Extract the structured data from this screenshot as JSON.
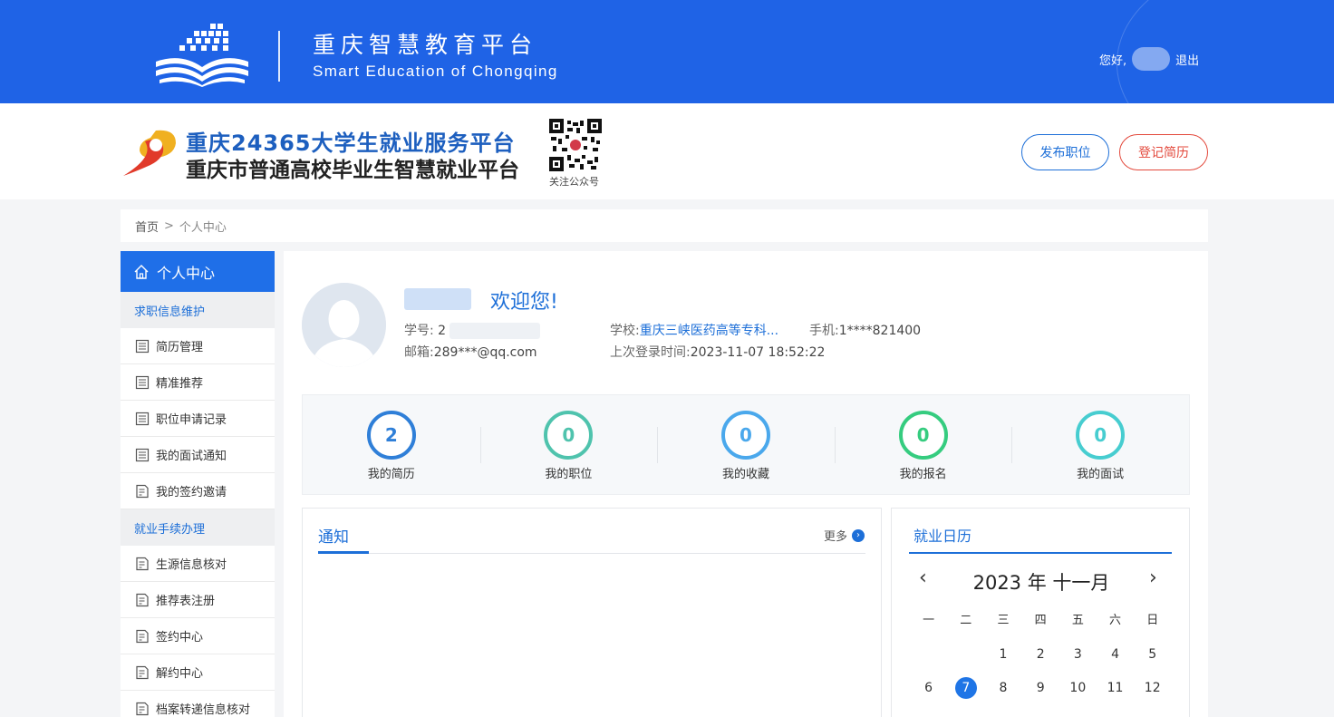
{
  "topbar": {
    "title": "重庆智慧教育平台",
    "subtitle": "Smart Education of Chongqing",
    "greeting": "您好,",
    "logout": "退出"
  },
  "header": {
    "title_line1": "重庆24365大学生就业服务平台",
    "title_line2": "重庆市普通高校毕业生智慧就业平台",
    "qr_label": "关注公众号",
    "publish_button": "发布职位",
    "register_button": "登记简历"
  },
  "breadcrumb": {
    "home": "首页",
    "separator": ">",
    "current": "个人中心"
  },
  "sidebar": {
    "head": "个人中心",
    "group1": "求职信息维护",
    "group1_items": [
      "简历管理",
      "精准推荐",
      "职位申请记录",
      "我的面试通知",
      "我的签约邀请"
    ],
    "group2": "就业手续办理",
    "group2_items": [
      "生源信息核对",
      "推荐表注册",
      "签约中心",
      "解约中心",
      "档案转递信息核对"
    ]
  },
  "profile": {
    "welcome": "欢迎您!",
    "student_id_label": "学号:",
    "student_id_value": "2",
    "school_label": "学校:",
    "school_value": "重庆三峡医药高等专科...",
    "phone_label": "手机:",
    "phone_value": "1****821400",
    "email_label": "邮箱:",
    "email_value": "289***@qq.com",
    "last_login_label": "上次登录时间:",
    "last_login_value": "2023-11-07 18:52:22"
  },
  "stats": [
    {
      "label": "我的简历",
      "value": "2",
      "color": "#2f7fd8"
    },
    {
      "label": "我的职位",
      "value": "0",
      "color": "#4fc3ad"
    },
    {
      "label": "我的收藏",
      "value": "0",
      "color": "#4aa8ec"
    },
    {
      "label": "我的报名",
      "value": "0",
      "color": "#35cc7f"
    },
    {
      "label": "我的面试",
      "value": "0",
      "color": "#47cdd0"
    }
  ],
  "notice": {
    "tab": "通知",
    "more": "更多"
  },
  "calendar": {
    "title": "就业日历",
    "month_label": "2023 年  十一月",
    "prev": "‹",
    "next": "›",
    "weekdays": [
      "一",
      "二",
      "三",
      "四",
      "五",
      "六",
      "日"
    ],
    "row1": [
      "",
      "",
      "1",
      "2",
      "3",
      "4",
      "5"
    ],
    "row2": [
      "6",
      "7",
      "8",
      "9",
      "10",
      "11",
      "12"
    ],
    "today": "7"
  },
  "colors": {
    "brand_blue": "#1f63e6",
    "accent_red": "#e3483b"
  }
}
